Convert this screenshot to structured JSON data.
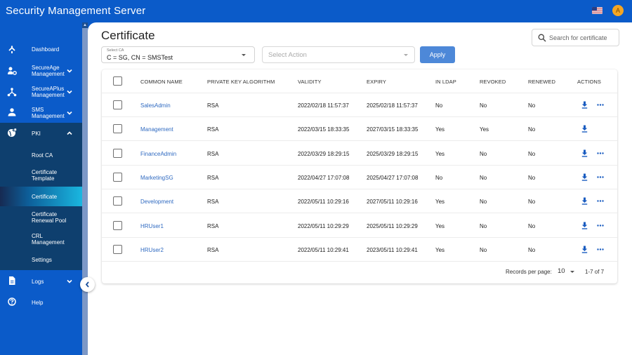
{
  "header": {
    "app_title": "Security Management Server",
    "avatar_initial": "A",
    "locale_flag": "us-flag"
  },
  "sidebar": {
    "items": [
      {
        "label": "Dashboard",
        "icon": "dashboard-icon"
      },
      {
        "label": "SecureAge Management",
        "icon": "user-gear-icon",
        "expandable": true
      },
      {
        "label": "SecureAPlus Management",
        "icon": "network-icon",
        "expandable": true
      },
      {
        "label": "SMS Management",
        "icon": "person-icon",
        "expandable": true
      },
      {
        "label": "PKI",
        "icon": "globe-lock-icon",
        "expanded": true
      },
      {
        "label": "Logs",
        "icon": "document-icon",
        "expandable": true
      },
      {
        "label": "Help",
        "icon": "help-icon"
      }
    ],
    "pki_subitems": [
      {
        "label": "Root CA"
      },
      {
        "label": "Certificate Template"
      },
      {
        "label": "Certificate",
        "active": true
      },
      {
        "label": "Certificate Renewal Pool"
      },
      {
        "label": "CRL Management"
      },
      {
        "label": "Settings"
      }
    ],
    "colors": {
      "primary": "#0b5bc9",
      "submenu": "#0e3f6e",
      "active_accent": "#1ab7e0"
    }
  },
  "main": {
    "title": "Certificate",
    "search_placeholder": "Search for certificate",
    "select_ca": {
      "label": "Select CA",
      "value": "C = SG, CN = SMSTest"
    },
    "select_action": {
      "placeholder": "Select Action"
    },
    "apply_label": "Apply",
    "table": {
      "columns": [
        "COMMON NAME",
        "PRIVATE KEY ALGORITHM",
        "VALIDITY",
        "EXPIRY",
        "IN LDAP",
        "REVOKED",
        "RENEWED",
        "ACTIONS"
      ],
      "rows": [
        {
          "name": "SalesAdmin",
          "algo": "RSA",
          "validity": "2022/02/18 11:57:37",
          "expiry": "2025/02/18 11:57:37",
          "in_ldap": "No",
          "revoked": "No",
          "renewed": "No",
          "more": true
        },
        {
          "name": "Management",
          "algo": "RSA",
          "validity": "2022/03/15 18:33:35",
          "expiry": "2027/03/15 18:33:35",
          "in_ldap": "Yes",
          "revoked": "Yes",
          "renewed": "No",
          "more": false
        },
        {
          "name": "FinanceAdmin",
          "algo": "RSA",
          "validity": "2022/03/29 18:29:15",
          "expiry": "2025/03/29 18:29:15",
          "in_ldap": "Yes",
          "revoked": "No",
          "renewed": "No",
          "more": true
        },
        {
          "name": "MarketingSG",
          "algo": "RSA",
          "validity": "2022/04/27 17:07:08",
          "expiry": "2025/04/27 17:07:08",
          "in_ldap": "No",
          "revoked": "No",
          "renewed": "No",
          "more": true
        },
        {
          "name": "Development",
          "algo": "RSA",
          "validity": "2022/05/11 10:29:16",
          "expiry": "2027/05/11 10:29:16",
          "in_ldap": "Yes",
          "revoked": "No",
          "renewed": "No",
          "more": true
        },
        {
          "name": "HRUser1",
          "algo": "RSA",
          "validity": "2022/05/11 10:29:29",
          "expiry": "2025/05/11 10:29:29",
          "in_ldap": "Yes",
          "revoked": "No",
          "renewed": "No",
          "more": true
        },
        {
          "name": "HRUser2",
          "algo": "RSA",
          "validity": "2022/05/11 10:29:41",
          "expiry": "2023/05/11 10:29:41",
          "in_ldap": "Yes",
          "revoked": "No",
          "renewed": "No",
          "more": true
        }
      ]
    },
    "pagination": {
      "records_per_page_label": "Records per page:",
      "records_per_page": "10",
      "range": "1-7 of 7"
    },
    "colors": {
      "link": "#2f6ac1",
      "apply_button": "#4d88d8",
      "action_icon": "#1a5cc0"
    }
  }
}
